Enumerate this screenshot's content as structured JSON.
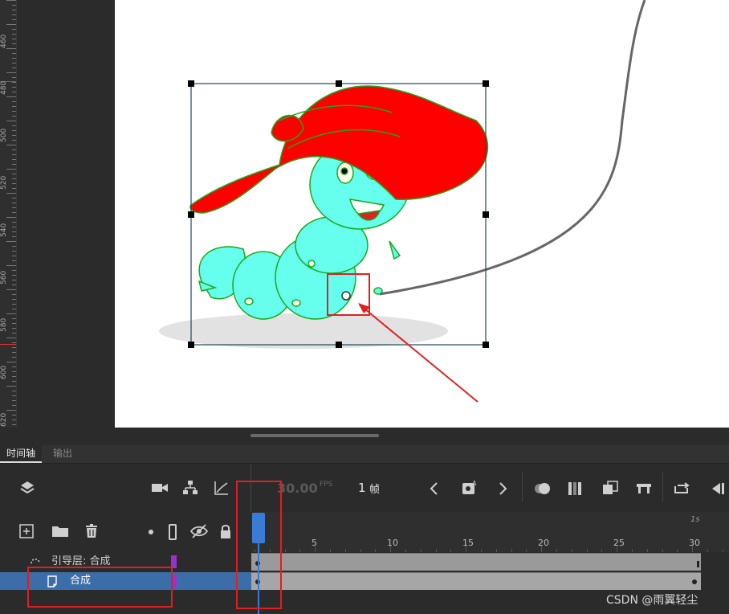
{
  "ruler": {
    "labels": [
      "460",
      "480",
      "500",
      "520",
      "540",
      "560",
      "580",
      "600",
      "620"
    ]
  },
  "tabs": {
    "timeline_label": "时间轴",
    "output_label": "输出"
  },
  "toolbar": {
    "fps_value": "30.00",
    "fps_unit": "FPS",
    "frame_value": "1",
    "frame_unit": "帧"
  },
  "timeline": {
    "seconds_label": "1s",
    "frame_labels": [
      "5",
      "10",
      "15",
      "20",
      "25",
      "30"
    ],
    "current_frame": 1,
    "total_frames": 30
  },
  "layers": [
    {
      "name": "引导层: 合成",
      "type": "guide-layer",
      "color": "#9b30d0"
    },
    {
      "name": "合成",
      "type": "guided-layer",
      "color": "#9b30d0",
      "selected": true
    }
  ],
  "colors": {
    "accent_blue": "#3a7bd5",
    "annotation_red": "#e02020",
    "hat_red": "#ff0000",
    "body_cyan": "#66ffee",
    "outline_green": "#1aa81a"
  },
  "watermark": "CSDN @雨翼轻尘"
}
